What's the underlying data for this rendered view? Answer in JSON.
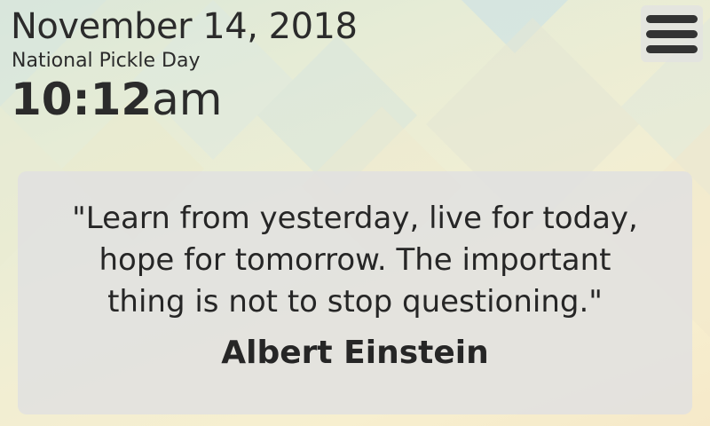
{
  "header": {
    "date": "November 14, 2018",
    "holiday": "National Pickle Day",
    "time_hm": "10:12",
    "time_ampm": "am"
  },
  "menu": {
    "icon": "hamburger-menu-icon"
  },
  "quote": {
    "text": "\"Learn from yesterday, live for today,\nhope for tomorrow.  The important\nthing is not to stop questioning.\"",
    "author": "Albert Einstein"
  },
  "colors": {
    "text": "#2b2b2b",
    "card_background": "#e1e1e1",
    "menu_bars": "#333333"
  }
}
